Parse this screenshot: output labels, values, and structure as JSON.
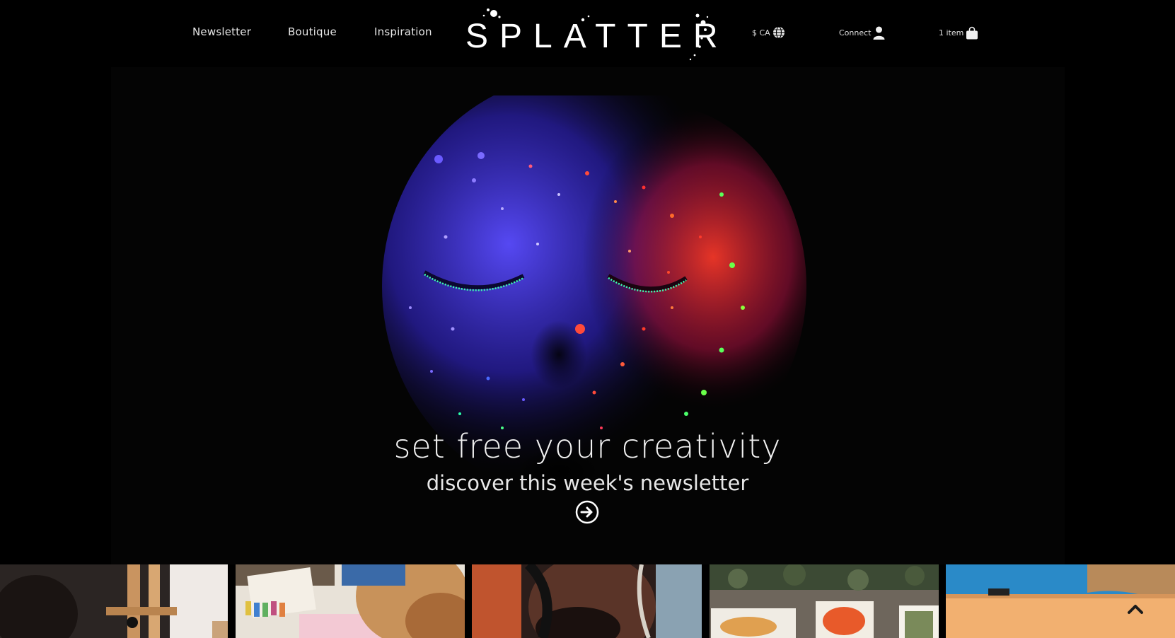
{
  "nav": {
    "newsletter": "Newsletter",
    "boutique": "Boutique",
    "inspiration": "Inspiration"
  },
  "brand": {
    "logo_text": "SPLATTER"
  },
  "utilities": {
    "currency": "$ CA",
    "account": "Connect",
    "cart": "1 item"
  },
  "hero": {
    "headline": "set free your creativity",
    "subheadline": "discover this week's newsletter"
  },
  "thumbnails": [
    {
      "subject": "artist at easel"
    },
    {
      "subject": "painting at table with paints"
    },
    {
      "subject": "portrait mural"
    },
    {
      "subject": "paintings on stone wall"
    },
    {
      "subject": "canvas on easel outdoors"
    }
  ],
  "colors": {
    "background": "#000000",
    "text": "#ffffff",
    "paint_blue": "#3b3bff",
    "paint_red": "#ff2a2a",
    "paint_green": "#39ff5a"
  },
  "icons": {
    "currency": "globe-icon",
    "account": "user-icon",
    "cart": "shopping-bag-icon",
    "cta": "circle-arrow-right-icon",
    "scroll": "chevron-up-icon"
  }
}
